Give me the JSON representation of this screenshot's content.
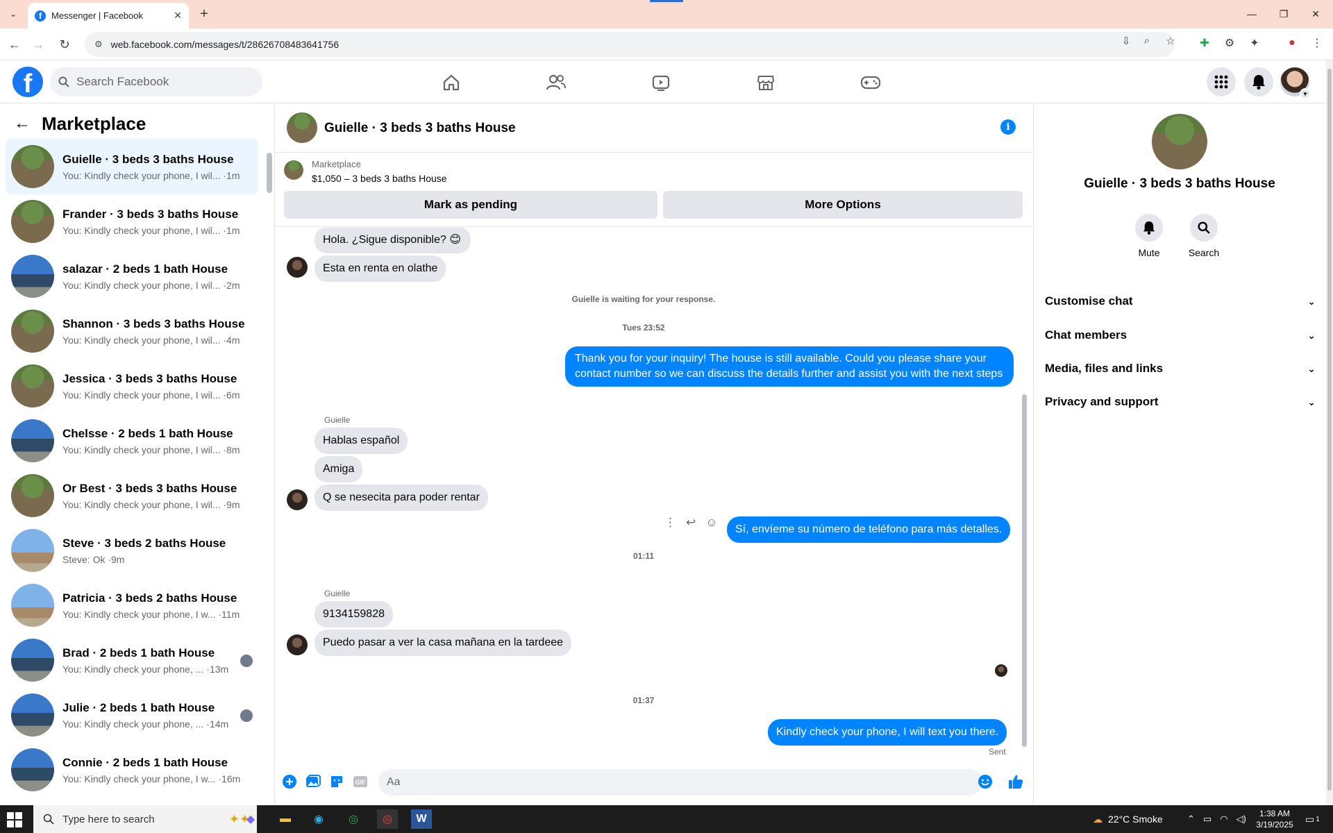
{
  "browser": {
    "tab_title": "Messenger | Facebook",
    "url": "web.facebook.com/messages/t/28626708483641756"
  },
  "fb": {
    "search_placeholder": "Search Facebook"
  },
  "sidebar": {
    "title": "Marketplace",
    "conversations": [
      {
        "name": "Guielle · 3 beds 3 baths House",
        "snippet": "You: Kindly check your phone, I wil... ·1m",
        "thumb": "garage"
      },
      {
        "name": "Frander · 3 beds 3 baths House",
        "snippet": "You: Kindly check your phone, I wil... ·1m",
        "thumb": "garage"
      },
      {
        "name": "salazar · 2 beds 1 bath House",
        "snippet": "You: Kindly check your phone, I wil... ·2m",
        "thumb": "blue"
      },
      {
        "name": "Shannon · 3 beds 3 baths House",
        "snippet": "You: Kindly check your phone, I wil... ·4m",
        "thumb": "garage"
      },
      {
        "name": "Jessica · 3 beds 3 baths House",
        "snippet": "You: Kindly check your phone, I wil... ·6m",
        "thumb": "garage"
      },
      {
        "name": "Chelsse · 2 beds 1 bath House",
        "snippet": "You: Kindly check your phone, I wil... ·8m",
        "thumb": "blue"
      },
      {
        "name": "Or Best · 3 beds 3 baths House",
        "snippet": "You: Kindly check your phone, I wil... ·9m",
        "thumb": "garage"
      },
      {
        "name": "Steve · 3 beds 2 baths House",
        "snippet": "Steve: Ok ·9m",
        "thumb": "sky"
      },
      {
        "name": "Patricia · 3 beds 2 baths House",
        "snippet": "You: Kindly check your phone, I w... ·11m",
        "thumb": "sky"
      },
      {
        "name": "Brad · 2 beds 1 bath House",
        "snippet": "You: Kindly check your phone, ... ·13m",
        "thumb": "blue"
      },
      {
        "name": "Julie · 2 beds 1 bath House",
        "snippet": "You: Kindly check your phone, ... ·14m",
        "thumb": "blue"
      },
      {
        "name": "Connie · 2 beds 1 bath House",
        "snippet": "You: Kindly check your phone, I w... ·16m",
        "thumb": "blue"
      }
    ]
  },
  "chat": {
    "title": "Guielle · 3 beds 3 baths House",
    "listing_label": "Marketplace",
    "listing_price": "$1,050 – 3 beds 3 baths House",
    "btn_pending": "Mark as pending",
    "btn_more": "More Options",
    "msg1": "Hola. ¿Sigue disponible? 😊",
    "msg2": "Esta en renta en olathe",
    "waiting": "Guielle is waiting for your response.",
    "time1": "Tues 23:52",
    "out1": "Thank you for your inquiry! The house is still available. Could you please share your contact number so we can discuss the details further and assist you with the next steps",
    "sender": "Guielle",
    "msg3": "Hablas español",
    "msg4": "Amiga",
    "msg5": "Q se nesecita para poder rentar",
    "out2": "Sí, envíeme su número de teléfono para más detalles.",
    "time2": "01:11",
    "msg6": "9134159828",
    "msg7": "Puedo pasar a ver la casa mañana en la tardeee",
    "time3": "01:37",
    "out3": "Kindly check your phone, I will text you there.",
    "sent": "Sent",
    "composer_placeholder": "Aa"
  },
  "rpanel": {
    "title": "Guielle · 3 beds 3 baths House",
    "mute": "Mute",
    "search": "Search",
    "rows": [
      "Customise chat",
      "Chat members",
      "Media, files and links",
      "Privacy and support"
    ]
  },
  "taskbar": {
    "search_placeholder": "Type here to search",
    "weather": "22°C  Smoke",
    "time": "1:38 AM",
    "date": "3/19/2025",
    "notif_count": "1"
  },
  "colors": {
    "fb_blue": "#1877f2",
    "messenger_blue": "#0084ff"
  }
}
